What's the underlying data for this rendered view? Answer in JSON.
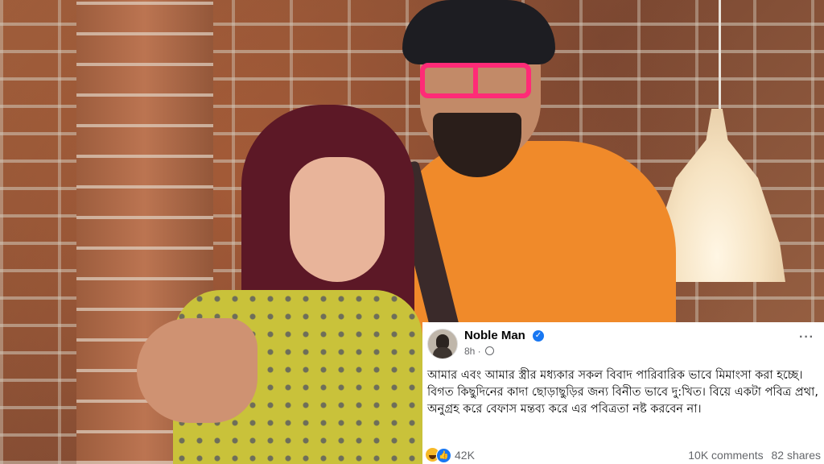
{
  "post": {
    "author": "Noble Man",
    "time": "8h ·",
    "more_label": "···",
    "text": "আমার এবং আমার স্ত্রীর মধ্যকার সকল বিবাদ পারিবারিক ভাবে মিমাংসা করা হচ্ছে। বিগত কিছুদিনের কাদা ছোড়াছুড়ির জন্য বিনীত ভাবে দু:খিত। বিয়ে একটা পবিত্র প্রথা, অনুগ্রহ করে বেফাস মন্তব্য করে এর পবিত্রতা নষ্ট করবেন না।",
    "reaction_count": "42K",
    "comments": "10K comments",
    "shares": "82 shares"
  },
  "icons": {
    "verified": "verified-badge-icon",
    "globe": "globe-icon",
    "reactions": [
      "haha-reaction-icon",
      "like-reaction-icon"
    ]
  },
  "colors": {
    "verified": "#1877f2",
    "meta_text": "#65676b",
    "shirt": "#f08a2a",
    "glasses": "#ff2b77"
  }
}
